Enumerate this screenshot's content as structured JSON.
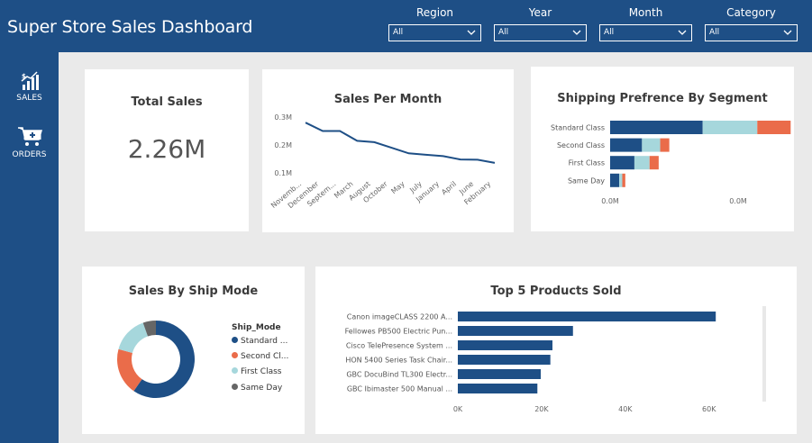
{
  "header": {
    "title": "Super Store Sales Dashboard",
    "filters": [
      {
        "label": "Region",
        "value": "All"
      },
      {
        "label": "Year",
        "value": "All"
      },
      {
        "label": "Month",
        "value": "All"
      },
      {
        "label": "Category",
        "value": "All"
      }
    ]
  },
  "sidebar": {
    "items": [
      {
        "label": "SALES",
        "icon": "sales-chart-icon"
      },
      {
        "label": "ORDERS",
        "icon": "cart-add-icon"
      }
    ]
  },
  "colors": {
    "primary": "#1e4f86",
    "secondary": "#a6d7dc",
    "tertiary": "#ea6c4a",
    "quaternary": "#666666"
  },
  "kpi": {
    "title": "Total Sales",
    "value": "2.26M"
  },
  "chart_data": [
    {
      "id": "sales-per-month",
      "type": "line",
      "title": "Sales Per Month",
      "x": [
        "November",
        "December",
        "September",
        "March",
        "August",
        "October",
        "May",
        "July",
        "January",
        "April",
        "June",
        "February"
      ],
      "x_tick_labels": [
        "Novemb...",
        "December",
        "Septem...",
        "March",
        "August",
        "October",
        "May",
        "July",
        "January",
        "April",
        "June",
        "February"
      ],
      "values": [
        0.28,
        0.25,
        0.25,
        0.215,
        0.21,
        0.19,
        0.17,
        0.165,
        0.16,
        0.148,
        0.147,
        0.136
      ],
      "y_ticks": [
        "0.1M",
        "0.2M",
        "0.3M"
      ],
      "ylim": [
        0.1,
        0.3
      ],
      "grid": false
    },
    {
      "id": "shipping-preference",
      "type": "bar",
      "orientation": "horizontal",
      "stacked": true,
      "title": "Shipping Prefrence By Segment",
      "categories": [
        "Standard Class",
        "Second Class",
        "First Class",
        "Same Day"
      ],
      "series": [
        {
          "values": [
            0.61,
            0.21,
            0.16,
            0.06
          ]
        },
        {
          "values": [
            0.36,
            0.12,
            0.1,
            0.02
          ]
        },
        {
          "values": [
            0.22,
            0.06,
            0.06,
            0.02
          ]
        }
      ],
      "x_ticks": [
        "0.0M",
        "0.0M"
      ],
      "xlim": [
        0,
        1.2
      ]
    },
    {
      "id": "sales-by-ship-mode",
      "type": "pie",
      "donut": true,
      "title": "Sales By Ship Mode",
      "legend_title": "Ship_Mode",
      "legend_position": "right",
      "slices": [
        {
          "label": "Standard ...",
          "value": 59.7
        },
        {
          "label": "Second Cl...",
          "value": 19.5
        },
        {
          "label": "First Class",
          "value": 15.4
        },
        {
          "label": "Same Day",
          "value": 5.4
        }
      ]
    },
    {
      "id": "top-5-products",
      "type": "bar",
      "orientation": "horizontal",
      "title": "Top 5 Products Sold",
      "categories": [
        "Canon imageCLASS 2200 A...",
        "Fellowes PB500 Electric Pun...",
        "Cisco TelePresence System ...",
        "HON 5400 Series Task Chair...",
        "GBC DocuBind TL300 Electr...",
        "GBC Ibimaster 500 Manual ..."
      ],
      "values": [
        61600,
        27500,
        22600,
        22100,
        19800,
        19000
      ],
      "x_ticks": [
        "0K",
        "20K",
        "40K",
        "60K"
      ],
      "xlim": [
        0,
        65000
      ]
    }
  ]
}
